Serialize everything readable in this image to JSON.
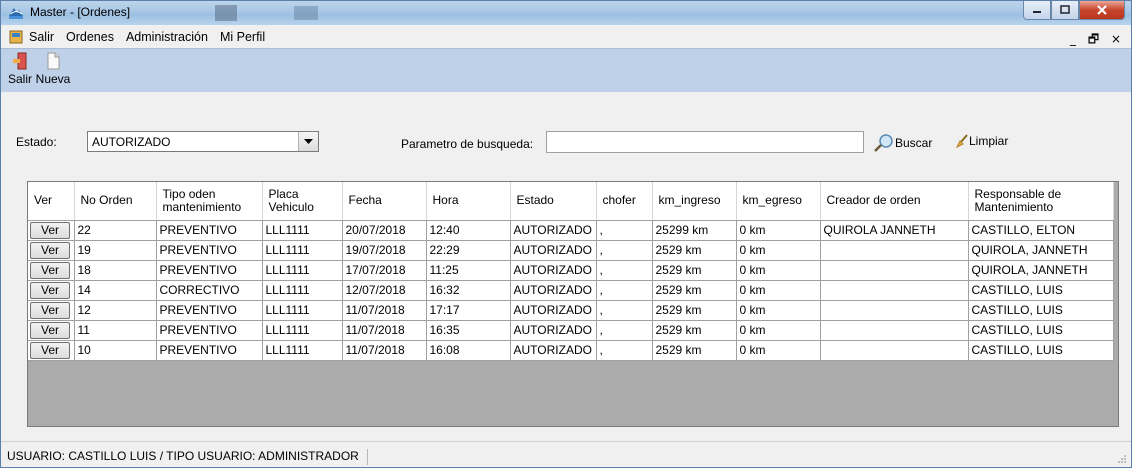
{
  "window": {
    "title": "Master - [Ordenes]",
    "controls": {
      "minimize": "–",
      "maximize": "□",
      "close": "X"
    }
  },
  "menu": {
    "items": [
      "Salir",
      "Ordenes",
      "Administración",
      "Mi Perfil"
    ],
    "mdi_controls": "_ 🗗 ×"
  },
  "toolbar": {
    "items": [
      {
        "label": "Salir",
        "icon": "exit-door-icon"
      },
      {
        "label": "Nueva",
        "icon": "new-document-icon"
      }
    ]
  },
  "filters": {
    "estado_label": "Estado:",
    "estado_value": "AUTORIZADO",
    "search_label": "Parametro de busqueda:",
    "search_value": "",
    "search_button": "Buscar",
    "clear_button": "Limpiar"
  },
  "grid": {
    "columns": [
      "Ver",
      "No Orden",
      "Tipo oden mantenimiento",
      "Placa Vehiculo",
      "Fecha",
      "Hora",
      "Estado",
      "chofer",
      "km_ingreso",
      "km_egreso",
      "Creador de orden",
      "Responsable de Mantenimiento"
    ],
    "button_label": "Ver",
    "rows": [
      [
        "22",
        "PREVENTIVO",
        "LLL1111",
        "20/07/2018",
        "12:40",
        "AUTORIZADO",
        ",",
        "25299 km",
        "0 km",
        "QUIROLA JANNETH",
        "CASTILLO, ELTON"
      ],
      [
        "19",
        "PREVENTIVO",
        "LLL1111",
        "19/07/2018",
        "22:29",
        "AUTORIZADO",
        ",",
        "2529 km",
        "0 km",
        "",
        "QUIROLA, JANNETH"
      ],
      [
        "18",
        "PREVENTIVO",
        "LLL1111",
        "17/07/2018",
        "11:25",
        "AUTORIZADO",
        ",",
        "2529 km",
        "0 km",
        "",
        "QUIROLA, JANNETH"
      ],
      [
        "14",
        "CORRECTIVO",
        "LLL1111",
        "12/07/2018",
        "16:32",
        "AUTORIZADO",
        ",",
        "2529 km",
        "0 km",
        "",
        "CASTILLO, LUIS"
      ],
      [
        "12",
        "PREVENTIVO",
        "LLL1111",
        "11/07/2018",
        "17:17",
        "AUTORIZADO",
        ",",
        "2529 km",
        "0 km",
        "",
        "CASTILLO, LUIS"
      ],
      [
        "11",
        "PREVENTIVO",
        "LLL1111",
        "11/07/2018",
        "16:35",
        "AUTORIZADO",
        ",",
        "2529 km",
        "0 km",
        "",
        "CASTILLO, LUIS"
      ],
      [
        "10",
        "PREVENTIVO",
        "LLL1111",
        "11/07/2018",
        "16:08",
        "AUTORIZADO",
        ",",
        "2529 km",
        "0 km",
        "",
        "CASTILLO, LUIS"
      ]
    ]
  },
  "status": {
    "text": "USUARIO: CASTILLO LUIS / TIPO USUARIO: ADMINISTRADOR"
  },
  "colors": {
    "toolbar_bg": "#bfd1e8",
    "titlebar_bg": "#a8c7e6",
    "grid_empty_bg": "#ababab",
    "close_button": "#c8452d"
  }
}
